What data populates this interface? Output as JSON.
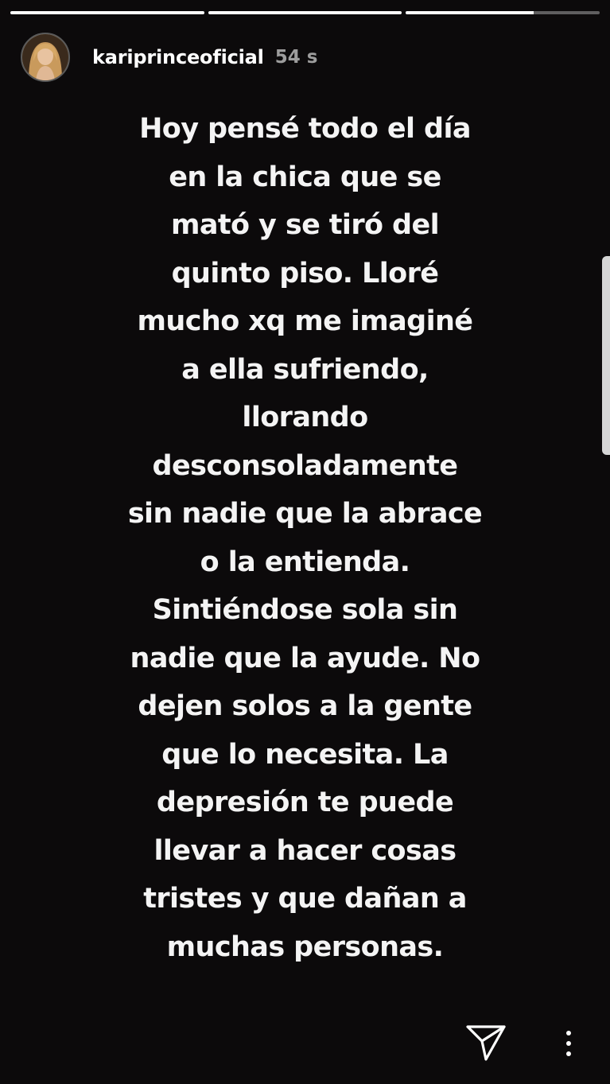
{
  "progress": {
    "segments": [
      1,
      1,
      0.66
    ]
  },
  "header": {
    "avatar_icon": "avatar",
    "username": "kariprinceoficial",
    "timestamp": "54 s"
  },
  "story": {
    "text": "Hoy pensé todo el día\nen la chica que se\nmató y se tiró del\nquinto piso. Lloré\nmucho xq me imaginé\na ella sufriendo,\nllorando\ndesconsoladamente\nsin nadie que la abrace\no la entienda.\nSintiéndose sola sin\nnadie que la ayude. No\ndejen solos a la gente\nque lo necesita. La\ndepresión te puede\nllevar a hacer cosas\ntristes y que dañan a\nmuchas personas."
  },
  "actions": {
    "send_icon": "paper-plane-icon",
    "more_icon": "more-vertical-icon"
  },
  "colors": {
    "background": "#0c0a0b",
    "text": "#f4f4f4",
    "progress_track": "rgba(255,255,255,0.35)",
    "progress_fill": "#ffffff"
  }
}
